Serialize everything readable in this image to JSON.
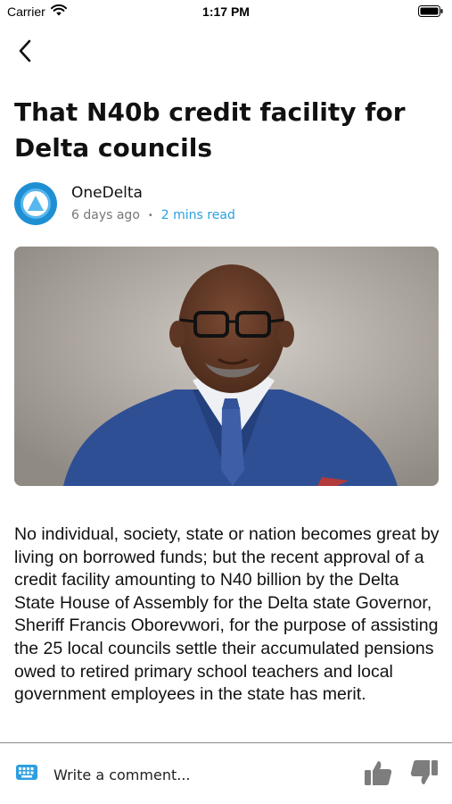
{
  "status_bar": {
    "carrier": "Carrier",
    "time": "1:17 PM"
  },
  "nav": {
    "back_icon": "chevron-left-icon"
  },
  "article": {
    "title": "That N40b credit facility for Delta councils",
    "author": {
      "name": "OneDelta",
      "avatar_text": "DELTA",
      "avatar_color": "#1f8fd4"
    },
    "posted": "6 days ago",
    "separator": "•",
    "read_time": "2 mins read",
    "read_time_color": "#2d9fe0",
    "body": "No individual, society, state or nation becomes great by living on borrowed funds; but the recent approval of a credit facility amounting to N40 billion by the Delta State House of Assembly for the Delta state  Governor, Sheriff Francis Oborevwori, for the purpose of assisting the 25 local councils settle their accumulated pensions owed to retired primary school teachers and local government employees in the state has merit."
  },
  "comment_bar": {
    "placeholder": "Write a comment...",
    "keyboard_icon": "keyboard-icon",
    "like_icon": "thumbs-up-icon",
    "dislike_icon": "thumbs-down-icon",
    "accent": "#2d9fe0"
  }
}
